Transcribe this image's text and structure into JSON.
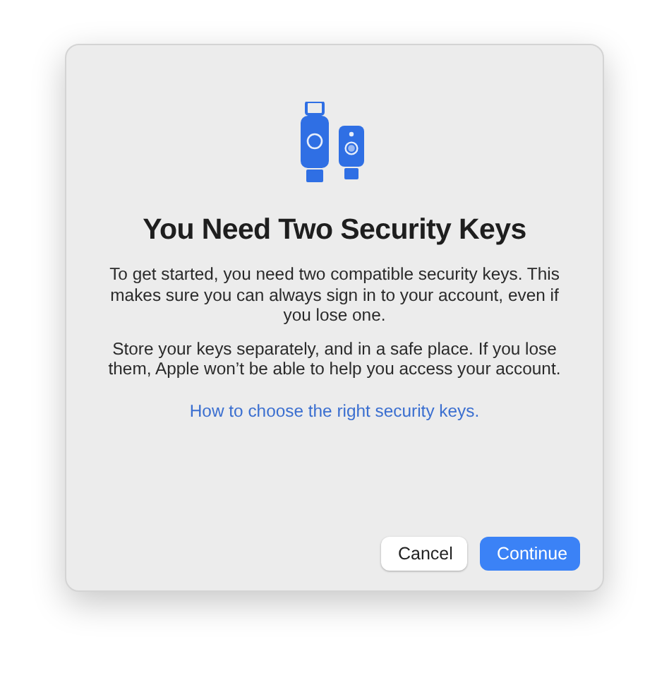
{
  "dialog": {
    "title": "You Need Two Security Keys",
    "paragraphs": [
      "To get started, you need two compatible security keys. This makes sure you can always sign in to your account, even if you lose one.",
      "Store your keys separately, and in a safe place. If you lose them, Apple won’t be able to help you access your account."
    ],
    "link": "How to choose the right security keys.",
    "buttons": [
      {
        "label": "Cancel",
        "kind": "secondary"
      },
      {
        "label": "Continue",
        "kind": "primary"
      }
    ]
  }
}
